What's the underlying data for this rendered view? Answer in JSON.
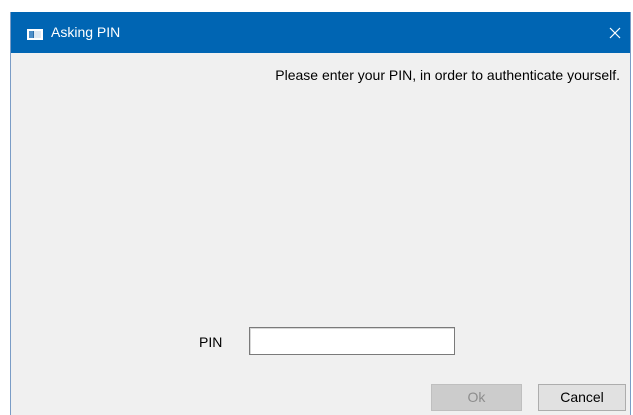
{
  "window": {
    "title": "Asking PIN",
    "app_icon": "dialog-app-icon",
    "close_icon": "close-icon"
  },
  "dialog": {
    "instruction": "Please enter your PIN, in order to authenticate yourself.",
    "pin_label": "PIN",
    "pin_value": "",
    "ok_label": "Ok",
    "ok_enabled": false,
    "cancel_label": "Cancel"
  },
  "colors": {
    "titlebar": "#0065b3",
    "background": "#f0f0f0",
    "ok_disabled_bg": "#cccccc",
    "ok_disabled_text": "#8d8d8d",
    "cancel_bg": "#e1e1e1"
  }
}
